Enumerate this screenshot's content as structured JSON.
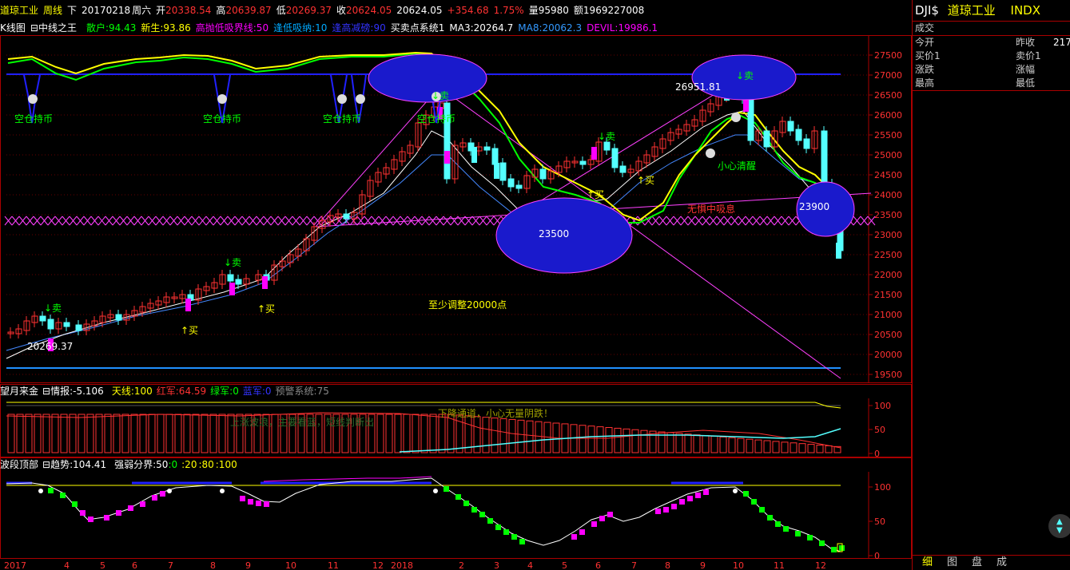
{
  "header": {
    "stock_name": "道琼工业",
    "period": "周线",
    "down_marker": "下",
    "date": "20170218",
    "weekday": "周六",
    "open_label": "开",
    "open": "20338.54",
    "high_label": "高",
    "high": "20639.87",
    "low_label": "低",
    "low": "20269.37",
    "close_label": "收",
    "close": "20624.05",
    "last": "20624.05",
    "change": "+354.68",
    "pct": "1.75%",
    "vol_label": "量",
    "vol": "95980",
    "amt_label": "额",
    "amt": "1969227008"
  },
  "indicator_bar": {
    "kline": "K线图",
    "midline": "中线之王",
    "sanhu": "散户:94.43",
    "xinsheng": "新生:93.86",
    "gaopao": "高抛低吸界线:50",
    "fengdi": "逢低吸纳:10",
    "gaodian": "逢高减磅:90",
    "maimai": "买卖点系统1",
    "ma3": "MA3:20264.7",
    "ma8": "MA8:20062.3",
    "devil": "DEVIL:19986.1"
  },
  "main_chart": {
    "y_ticks": [
      "27500",
      "27000",
      "26500",
      "26000",
      "25500",
      "25000",
      "24500",
      "24000",
      "23500",
      "23000",
      "22500",
      "22000",
      "21500",
      "21000",
      "20500",
      "20000",
      "19500"
    ],
    "annotations": {
      "sell1": "↓卖",
      "sell2": "↓卖",
      "sell3": "↓卖",
      "sell4": "↓卖",
      "sell5": "↓卖",
      "buy1": "↑买",
      "buy2": "↑买",
      "buy3": "↑买",
      "buy4": "↑买",
      "low_price": "20269.37",
      "high_price": "26951.81",
      "circle_mid": "23500",
      "circle_right": "23900",
      "kongcang1": "空仓持币",
      "kongcang2": "空仓持币",
      "kongcang3": "空仓持币",
      "kongcang4": "空仓持币",
      "xiaoxin": "小心清醒",
      "wuzhong": "无惧中吸息",
      "zhishao": "至少调整20000点"
    }
  },
  "panel1": {
    "title": "望月来金",
    "qingbao": "情报:-5.106",
    "tianxian": "天线:100",
    "hongjun": "红军:64.59",
    "lvjun": "绿军:0",
    "lanjun": "蓝军:0",
    "yujing": "预警系统:75",
    "note1": "上涨波浪，主要看蓝，短线判断出",
    "note2": "下降通道，小心无量阴跌！",
    "y_ticks": [
      "100",
      "50",
      "0"
    ]
  },
  "panel2": {
    "title": "波段顶部",
    "qushi": "趋势:104.41",
    "qiangruo": "强弱分界:50",
    "v0": ":0",
    "v20": ":20",
    "v80": ":80",
    "v100": ":100",
    "y_ticks": [
      "100",
      "50",
      "0"
    ]
  },
  "x_axis": [
    "2017",
    "4",
    "5",
    "6",
    "7",
    "8",
    "9",
    "10",
    "11",
    "12",
    "2018",
    "2",
    "3",
    "4",
    "5",
    "6",
    "7",
    "8",
    "9",
    "10",
    "11",
    "12"
  ],
  "side": {
    "code": "DJI$",
    "name": "道琼工业",
    "type": "INDX",
    "row0": "成交",
    "rows": [
      {
        "l": "今开",
        "r": "昨收",
        "v": "217"
      },
      {
        "l": "买价1",
        "r": "卖价1",
        "v": ""
      },
      {
        "l": "涨跌",
        "r": "涨幅",
        "v": ""
      },
      {
        "l": "最高",
        "r": "最低",
        "v": ""
      }
    ],
    "tabs": [
      "细",
      "图",
      "盘",
      "成"
    ]
  },
  "colors": {
    "up": "#ff3232",
    "down": "#54ffff",
    "yellow": "#ffff00",
    "magenta": "#ff00ff",
    "blue": "#0000ff",
    "green": "#00ff00"
  }
}
